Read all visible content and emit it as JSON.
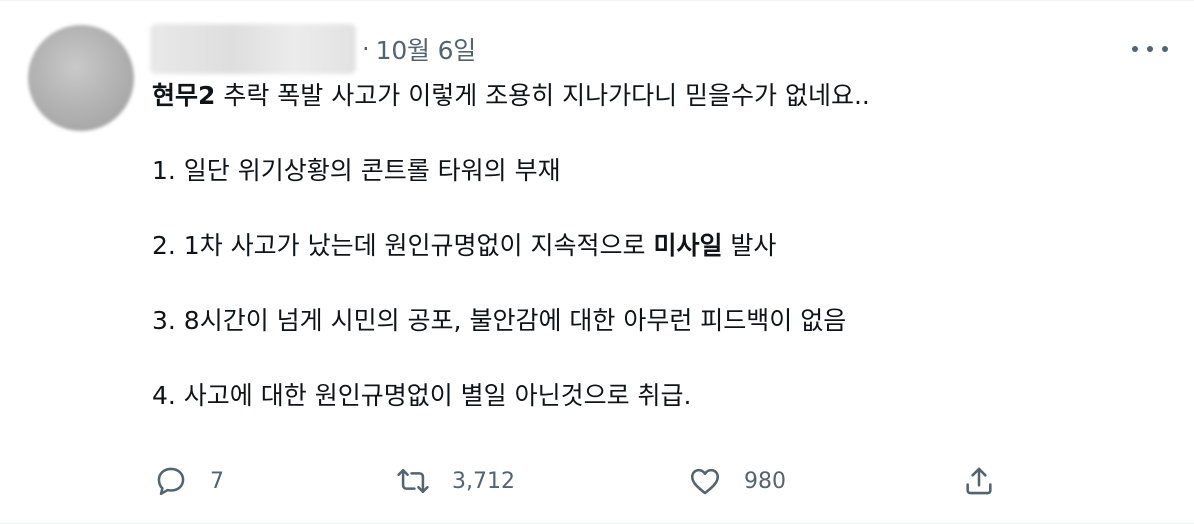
{
  "tweet": {
    "separator": "·",
    "date": "10월 6일",
    "lines": [
      {
        "bold": "현무2",
        "rest": " 추락 폭발 사고가 이렇게 조용히 지나가다니 믿을수가 없네요.."
      },
      {
        "text": "1. 일단 위기상황의 콘트롤 타워의 부재"
      },
      {
        "before": "2. 1차 사고가 났는데 원인규명없이 지속적으로 ",
        "bold": "미사일",
        "after": " 발사"
      },
      {
        "text": "3. 8시간이 넘게 시민의 공포, 불안감에 대한 아무런 피드백이 없음"
      },
      {
        "text": "4. 사고에 대한 원인규명없이 별일 아닌것으로 취급."
      }
    ]
  },
  "actions": {
    "reply_count": "7",
    "retweet_count": "3,712",
    "like_count": "980"
  },
  "icons": {
    "more": "more-horizontal-icon",
    "reply": "reply-bubble-icon",
    "retweet": "retweet-icon",
    "like": "heart-icon",
    "share": "share-upload-icon"
  },
  "colors": {
    "text": "#0f1419",
    "secondary": "#536471",
    "border": "#eff3f4"
  }
}
